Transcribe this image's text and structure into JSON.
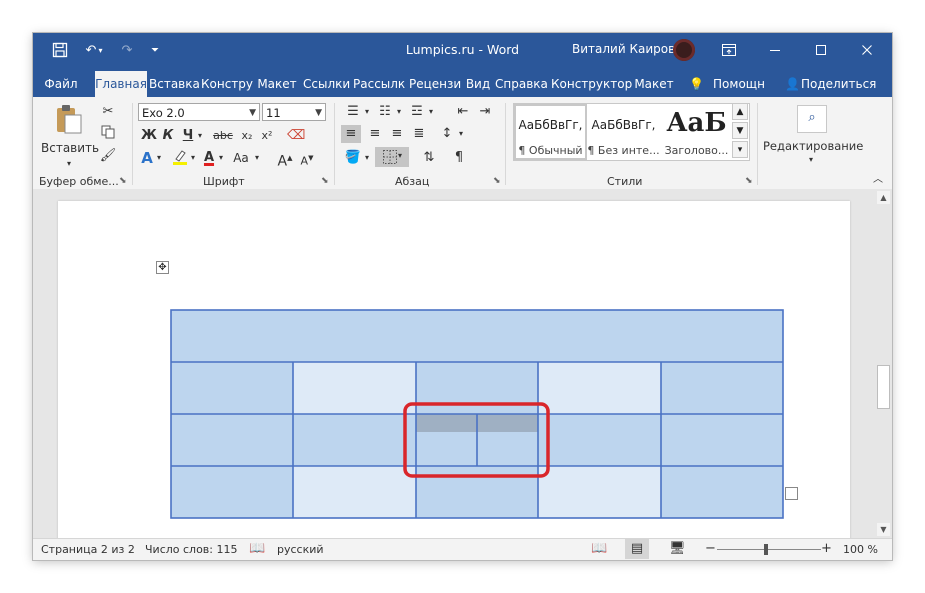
{
  "window": {
    "title": "Lumpics.ru  -  Word",
    "user_name": "Виталий Каиров"
  },
  "tabs": [
    {
      "label": "Файл"
    },
    {
      "label": "Главная",
      "active": true
    },
    {
      "label": "Вставка"
    },
    {
      "label": "Констру"
    },
    {
      "label": "Макет"
    },
    {
      "label": "Ссылки"
    },
    {
      "label": "Рассылк"
    },
    {
      "label": "Рецензи"
    },
    {
      "label": "Вид"
    },
    {
      "label": "Справка"
    },
    {
      "label": "Конструктор"
    },
    {
      "label": "Макет"
    },
    {
      "label": "Помощн"
    },
    {
      "label": "Поделиться"
    }
  ],
  "ribbon": {
    "clipboard": {
      "paste_label": "Вставить",
      "group_label": "Буфер обме..."
    },
    "font": {
      "font_name": "Exo 2.0",
      "font_size": "11",
      "group_label": "Шрифт",
      "bold": "Ж",
      "italic": "К",
      "underline": "Ч",
      "strike": "abc",
      "sub": "x₂",
      "sup": "x²",
      "grow": "A",
      "shrink": "A",
      "case": "Aa"
    },
    "paragraph": {
      "group_label": "Абзац",
      "pilcrow": "¶"
    },
    "styles": {
      "group_label": "Стили",
      "items": [
        {
          "sample": "АаБбВвГг,",
          "name": "¶ Обычный"
        },
        {
          "sample": "АаБбВвГг,",
          "name": "¶ Без инте..."
        },
        {
          "sample": "АаБ",
          "name": "Заголово..."
        }
      ]
    },
    "editing": {
      "label": "Редактирование"
    }
  },
  "status": {
    "page": "Страница 2 из 2",
    "words": "Число слов: 115",
    "language": "русский",
    "zoom": "100 %",
    "zoom_minus": "−",
    "zoom_plus": "+"
  },
  "colors": {
    "accent": "#2b579a",
    "cell_dark": "#bdd5ee",
    "cell_light": "#deeaf7",
    "cell_selected": "#9fb0c3",
    "table_border": "#4a72c4",
    "highlight_frame": "#d9262b"
  },
  "table": {
    "header_row": true,
    "rows": 3,
    "columns": 5,
    "split_cell": {
      "row": 2,
      "column": 3,
      "parts": 2,
      "selected_top": true
    }
  }
}
